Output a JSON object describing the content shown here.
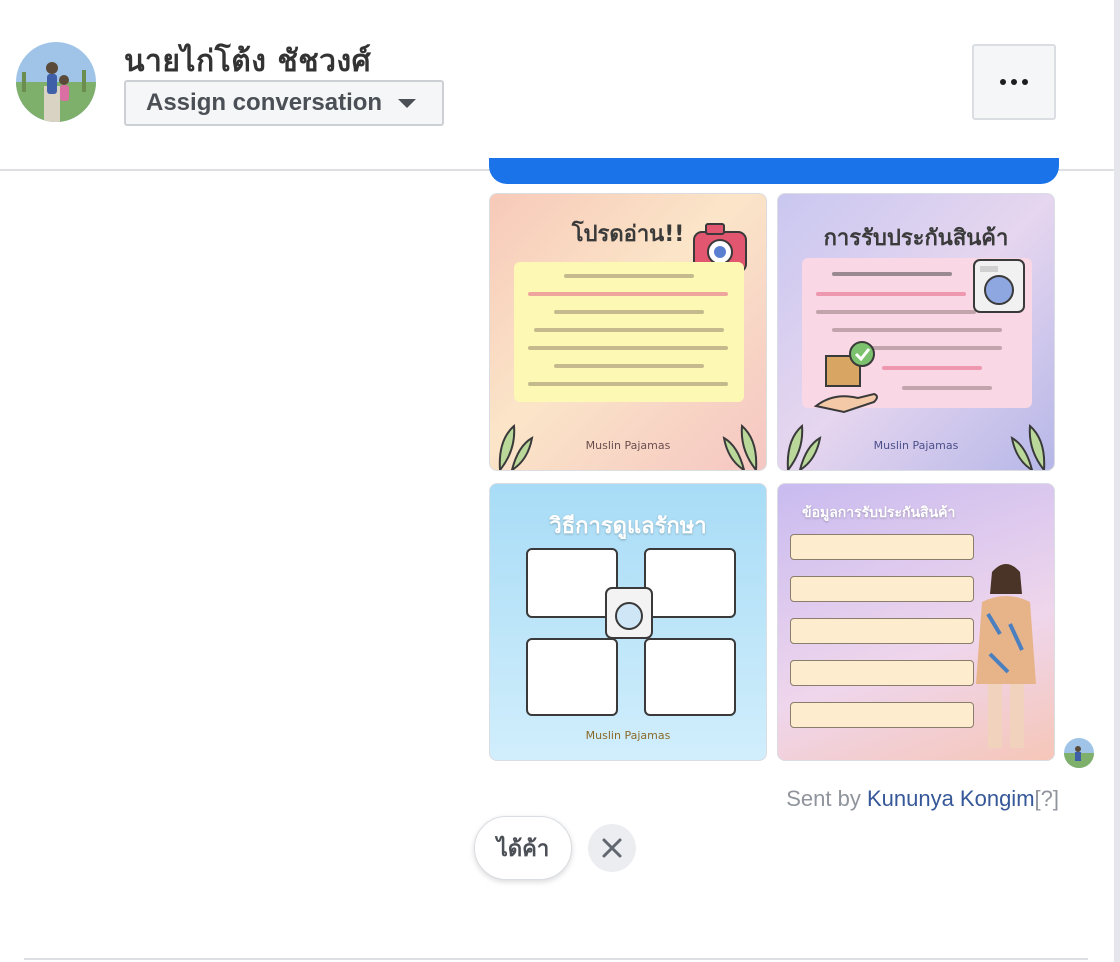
{
  "header": {
    "contact_name": "นายไก่โต้ง ชัชวงศ์",
    "assign_label": "Assign conversation"
  },
  "message": {
    "images": [
      {
        "title": "โปรดอ่าน!!",
        "brand": "Muslin Pajamas",
        "colors": [
          "#f7c9b9",
          "#fdf9b5"
        ]
      },
      {
        "title": "การรับประกันสินค้า",
        "brand": "Muslin Pajamas",
        "colors": [
          "#c9c7f0",
          "#f9d7e4"
        ]
      },
      {
        "title": "วิธีการดูแลรักษา",
        "brand": "Muslin Pajamas",
        "colors": [
          "#a8dcf6",
          "#ffffff"
        ]
      },
      {
        "title": "ข้อมูลการรับประกันสินค้า",
        "colors": [
          "#c9bbf0",
          "#fdeccd"
        ]
      }
    ],
    "sent_by_prefix": "Sent by ",
    "sent_by_name": "Kununya Kongim",
    "sent_by_suffix": "[?]"
  },
  "quick_reply": {
    "label": "ได้ค้า"
  },
  "colors": {
    "accent_blue": "#1a73e8",
    "link": "#365899",
    "muted": "#90949c"
  },
  "icons": [
    "more-icon",
    "caret-down-icon",
    "close-icon"
  ]
}
